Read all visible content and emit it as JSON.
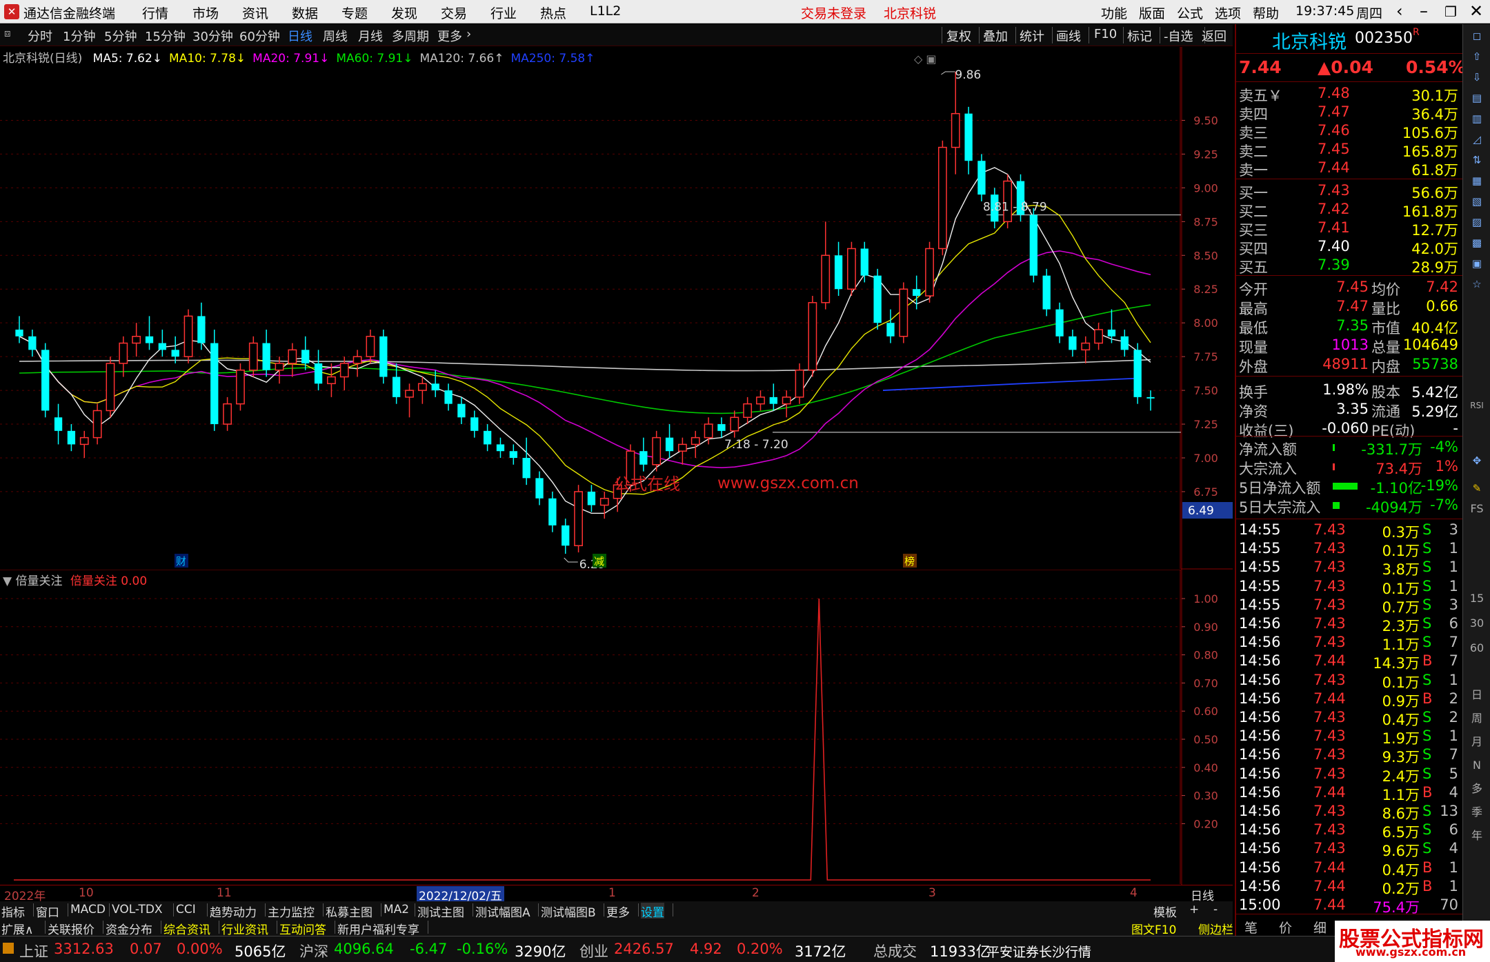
{
  "window": {
    "app_title": "通达信金融终端",
    "menus": [
      "行情",
      "市场",
      "资讯",
      "数据",
      "专题",
      "发现",
      "交易",
      "行业",
      "热点",
      "L1L2"
    ],
    "trade_status": "交易未登录",
    "stock_title": "北京科锐",
    "right_menus": [
      "功能",
      "版面",
      "公式",
      "选项",
      "帮助"
    ],
    "time": "19:37:45",
    "weekday": "周四"
  },
  "periods": {
    "items": [
      "分时",
      "1分钟",
      "5分钟",
      "15分钟",
      "30分钟",
      "60分钟",
      "日线",
      "周线",
      "月线",
      "多周期",
      "更多"
    ],
    "active": "日线",
    "right_tools": [
      "复权",
      "叠加",
      "统计",
      "画线",
      "F10",
      "标记",
      "-自选",
      "返回"
    ]
  },
  "main": {
    "label": "北京科锐(日线)",
    "ma": [
      {
        "name": "MA5: 7.62",
        "color": "#ffffff",
        "arrow": "↓"
      },
      {
        "name": "MA10: 7.78",
        "color": "#ffff00",
        "arrow": "↓"
      },
      {
        "name": "MA20: 7.91",
        "color": "#ff00ff",
        "arrow": "↓"
      },
      {
        "name": "MA60: 7.91",
        "color": "#00e600",
        "arrow": "↓"
      },
      {
        "name": "MA120: 7.66",
        "color": "#c0c0c0",
        "arrow": "↑"
      },
      {
        "name": "MA250: 7.58",
        "color": "#2040ff",
        "arrow": "↑"
      }
    ],
    "annotations": {
      "high": "9.86",
      "low": "6.29",
      "range_high": "8.81 - 8.79",
      "range_low": "7.18 - 7.20",
      "current_tag": "6.49",
      "site_text": "公式在线",
      "site_url": "www.gszx.com.cn",
      "markers": [
        "财",
        "减",
        "榜"
      ]
    }
  },
  "indicator": {
    "name": "倍量关注",
    "value_label": "倍量关注",
    "value": "0.00"
  },
  "y_axis_main": [
    "9.50",
    "9.25",
    "9.00",
    "8.75",
    "8.50",
    "8.25",
    "8.00",
    "7.75",
    "7.50",
    "7.25",
    "7.00",
    "6.75"
  ],
  "y_axis_sub": [
    "1.00",
    "0.90",
    "0.80",
    "0.70",
    "0.60",
    "0.50",
    "0.40",
    "0.30",
    "0.20"
  ],
  "x_axis": {
    "labels": [
      "2022年",
      "10",
      "11",
      "2022/12/02/五",
      "1",
      "2",
      "3",
      "4"
    ],
    "period": "日线"
  },
  "tabs_row1": [
    "指标",
    "窗口",
    "MACD",
    "VOL-TDX",
    "CCI",
    "趋势动力",
    "主力监控",
    "私募主图",
    "MA2",
    "测试主图",
    "测试幅图A",
    "测试幅图B",
    "更多",
    "设置"
  ],
  "tabs_row1_right": [
    "模板",
    "+",
    "-"
  ],
  "tabs_row2": [
    "扩展∧",
    "关联报价",
    "资金分布",
    "综合资讯",
    "行业资讯",
    "互动问答",
    "新用户福利专享"
  ],
  "tabs_row2_right": [
    "图文F10",
    "侧边栏《"
  ],
  "quote": {
    "name": "北京科锐",
    "code": "002350",
    "code_flag": "R",
    "price": "7.44",
    "change": "▲0.04",
    "pct": "0.54%",
    "asks": [
      {
        "label": "卖五",
        "price": "7.48",
        "vol": "30.1万"
      },
      {
        "label": "卖四",
        "price": "7.47",
        "vol": "36.4万"
      },
      {
        "label": "卖三",
        "price": "7.46",
        "vol": "105.6万"
      },
      {
        "label": "卖二",
        "price": "7.45",
        "vol": "165.8万"
      },
      {
        "label": "卖一",
        "price": "7.44",
        "vol": "61.8万"
      }
    ],
    "bids": [
      {
        "label": "买一",
        "price": "7.43",
        "vol": "56.6万"
      },
      {
        "label": "买二",
        "price": "7.42",
        "vol": "161.8万"
      },
      {
        "label": "买三",
        "price": "7.41",
        "vol": "12.7万"
      },
      {
        "label": "买四",
        "price": "7.40",
        "vol": "42.0万"
      },
      {
        "label": "买五",
        "price": "7.39",
        "vol": "28.9万"
      }
    ],
    "stats": [
      [
        "今开",
        "7.45",
        "均价",
        "7.42"
      ],
      [
        "最高",
        "7.47",
        "量比",
        "0.66"
      ],
      [
        "最低",
        "7.35",
        "市值",
        "40.4亿"
      ],
      [
        "现量",
        "1013",
        "总量",
        "104649"
      ],
      [
        "外盘",
        "48911",
        "内盘",
        "55738"
      ],
      [
        "换手",
        "1.98%",
        "股本",
        "5.42亿"
      ],
      [
        "净资",
        "3.35",
        "流通",
        "5.29亿"
      ],
      [
        "收益(三)",
        "-0.060",
        "PE(动)",
        "-"
      ]
    ],
    "flows": [
      [
        "净流入额",
        "-331.7万",
        "-4%"
      ],
      [
        "大宗流入",
        "73.4万",
        "1%"
      ],
      [
        "5日净流入额",
        "-1.10亿",
        "-19%"
      ],
      [
        "5日大宗流入",
        "-4094万",
        "-7%"
      ]
    ],
    "ticks": [
      [
        "14:55",
        "7.43",
        "0.3万",
        "S",
        "3"
      ],
      [
        "14:55",
        "7.43",
        "0.1万",
        "S",
        "1"
      ],
      [
        "14:55",
        "7.43",
        "3.8万",
        "S",
        "1"
      ],
      [
        "14:55",
        "7.43",
        "0.1万",
        "S",
        "1"
      ],
      [
        "14:55",
        "7.43",
        "0.7万",
        "S",
        "3"
      ],
      [
        "14:56",
        "7.43",
        "2.3万",
        "S",
        "6"
      ],
      [
        "14:56",
        "7.43",
        "1.1万",
        "S",
        "7"
      ],
      [
        "14:56",
        "7.44",
        "14.3万",
        "B",
        "7"
      ],
      [
        "14:56",
        "7.43",
        "0.1万",
        "S",
        "1"
      ],
      [
        "14:56",
        "7.44",
        "0.9万",
        "B",
        "2"
      ],
      [
        "14:56",
        "7.43",
        "0.4万",
        "S",
        "2"
      ],
      [
        "14:56",
        "7.43",
        "1.9万",
        "S",
        "1"
      ],
      [
        "14:56",
        "7.43",
        "9.3万",
        "S",
        "7"
      ],
      [
        "14:56",
        "7.43",
        "2.4万",
        "S",
        "5"
      ],
      [
        "14:56",
        "7.44",
        "1.1万",
        "B",
        "4"
      ],
      [
        "14:56",
        "7.43",
        "8.6万",
        "S",
        "13"
      ],
      [
        "14:56",
        "7.43",
        "6.5万",
        "S",
        "6"
      ],
      [
        "14:56",
        "7.43",
        "9.6万",
        "S",
        "4"
      ],
      [
        "14:56",
        "7.44",
        "0.4万",
        "B",
        "1"
      ],
      [
        "14:56",
        "7.44",
        "0.2万",
        "B",
        "1"
      ],
      [
        "15:00",
        "7.44",
        "75.4万",
        "",
        "70"
      ]
    ],
    "bottom_tabs": [
      "笔",
      "价",
      "细",
      "势"
    ]
  },
  "status": {
    "items": [
      [
        "上证",
        "3312.63",
        "0.07",
        "0.00%",
        "5065亿"
      ],
      [
        "沪深",
        "4096.64",
        "-6.47",
        "-0.16%",
        "3290亿"
      ],
      [
        "创业",
        "2426.57",
        "4.92",
        "0.20%",
        "3172亿"
      ]
    ],
    "total_label": "总成交",
    "total": "11933亿",
    "broker": "平安证券长沙行情"
  },
  "side_tools": [
    "日",
    "周",
    "月",
    "N",
    "多",
    "季",
    "年",
    "15",
    "30",
    "60",
    "RSI",
    "FS"
  ],
  "watermark": "股票公式指标网",
  "watermark_url": "www.gszx.com.cn",
  "chart_data": {
    "type": "candlestick",
    "ylim": [
      6.29,
      9.86
    ],
    "candles": [
      [
        7.95,
        8.05,
        7.85,
        7.9
      ],
      [
        7.9,
        7.95,
        7.75,
        7.8
      ],
      [
        7.8,
        7.85,
        7.3,
        7.35
      ],
      [
        7.3,
        7.4,
        7.1,
        7.2
      ],
      [
        7.2,
        7.25,
        7.05,
        7.1
      ],
      [
        7.1,
        7.2,
        7.0,
        7.15
      ],
      [
        7.15,
        7.4,
        7.1,
        7.35
      ],
      [
        7.35,
        7.75,
        7.3,
        7.7
      ],
      [
        7.7,
        7.9,
        7.6,
        7.85
      ],
      [
        7.85,
        8.0,
        7.75,
        7.9
      ],
      [
        7.9,
        8.05,
        7.8,
        7.85
      ],
      [
        7.85,
        7.95,
        7.75,
        7.8
      ],
      [
        7.8,
        7.9,
        7.7,
        7.75
      ],
      [
        7.75,
        8.1,
        7.7,
        8.05
      ],
      [
        8.05,
        8.15,
        7.8,
        7.85
      ],
      [
        7.85,
        7.95,
        7.2,
        7.25
      ],
      [
        7.25,
        7.45,
        7.2,
        7.4
      ],
      [
        7.4,
        7.7,
        7.35,
        7.65
      ],
      [
        7.65,
        7.9,
        7.6,
        7.85
      ],
      [
        7.85,
        7.95,
        7.6,
        7.65
      ],
      [
        7.65,
        7.75,
        7.55,
        7.7
      ],
      [
        7.7,
        7.85,
        7.6,
        7.8
      ],
      [
        7.8,
        7.9,
        7.65,
        7.7
      ],
      [
        7.7,
        7.8,
        7.5,
        7.55
      ],
      [
        7.55,
        7.7,
        7.45,
        7.6
      ],
      [
        7.6,
        7.75,
        7.5,
        7.7
      ],
      [
        7.7,
        7.8,
        7.6,
        7.75
      ],
      [
        7.75,
        7.95,
        7.7,
        7.9
      ],
      [
        7.9,
        7.95,
        7.55,
        7.6
      ],
      [
        7.6,
        7.7,
        7.4,
        7.45
      ],
      [
        7.45,
        7.55,
        7.3,
        7.5
      ],
      [
        7.5,
        7.6,
        7.4,
        7.55
      ],
      [
        7.55,
        7.65,
        7.45,
        7.5
      ],
      [
        7.5,
        7.55,
        7.35,
        7.4
      ],
      [
        7.4,
        7.45,
        7.25,
        7.3
      ],
      [
        7.3,
        7.35,
        7.15,
        7.2
      ],
      [
        7.2,
        7.25,
        7.05,
        7.1
      ],
      [
        7.1,
        7.15,
        7.0,
        7.05
      ],
      [
        7.05,
        7.1,
        6.95,
        7.0
      ],
      [
        7.0,
        7.15,
        6.8,
        6.85
      ],
      [
        6.85,
        6.9,
        6.65,
        6.7
      ],
      [
        6.7,
        6.75,
        6.45,
        6.5
      ],
      [
        6.5,
        6.55,
        6.29,
        6.35
      ],
      [
        6.35,
        6.8,
        6.3,
        6.75
      ],
      [
        6.75,
        6.8,
        6.6,
        6.65
      ],
      [
        6.65,
        6.75,
        6.55,
        6.7
      ],
      [
        6.7,
        6.85,
        6.6,
        6.8
      ],
      [
        6.8,
        7.1,
        6.75,
        7.05
      ],
      [
        7.05,
        7.15,
        6.9,
        6.95
      ],
      [
        6.95,
        7.2,
        6.9,
        7.15
      ],
      [
        7.15,
        7.25,
        7.0,
        7.05
      ],
      [
        7.05,
        7.15,
        6.95,
        7.1
      ],
      [
        7.1,
        7.2,
        7.0,
        7.15
      ],
      [
        7.15,
        7.3,
        7.1,
        7.25
      ],
      [
        7.25,
        7.3,
        7.15,
        7.2
      ],
      [
        7.2,
        7.35,
        7.15,
        7.3
      ],
      [
        7.3,
        7.45,
        7.25,
        7.4
      ],
      [
        7.4,
        7.5,
        7.35,
        7.45
      ],
      [
        7.45,
        7.55,
        7.35,
        7.4
      ],
      [
        7.4,
        7.5,
        7.3,
        7.45
      ],
      [
        7.45,
        7.7,
        7.4,
        7.65
      ],
      [
        7.65,
        8.2,
        7.6,
        8.15
      ],
      [
        8.15,
        8.75,
        8.1,
        8.5
      ],
      [
        8.5,
        8.6,
        8.2,
        8.25
      ],
      [
        8.25,
        8.6,
        8.2,
        8.55
      ],
      [
        8.55,
        8.6,
        8.3,
        8.35
      ],
      [
        8.35,
        8.4,
        7.95,
        8.0
      ],
      [
        8.0,
        8.1,
        7.85,
        7.9
      ],
      [
        7.9,
        8.3,
        7.85,
        8.25
      ],
      [
        8.25,
        8.35,
        8.1,
        8.2
      ],
      [
        8.2,
        8.6,
        8.15,
        8.55
      ],
      [
        8.55,
        9.35,
        8.5,
        9.3
      ],
      [
        9.3,
        9.86,
        9.1,
        9.55
      ],
      [
        9.55,
        9.6,
        9.1,
        9.2
      ],
      [
        9.2,
        9.25,
        8.9,
        8.95
      ],
      [
        8.95,
        9.0,
        8.7,
        8.75
      ],
      [
        8.75,
        9.1,
        8.7,
        9.05
      ],
      [
        9.05,
        9.1,
        8.75,
        8.8
      ],
      [
        8.8,
        8.85,
        8.3,
        8.35
      ],
      [
        8.35,
        8.4,
        8.05,
        8.1
      ],
      [
        8.1,
        8.15,
        7.85,
        7.9
      ],
      [
        7.9,
        7.95,
        7.75,
        7.8
      ],
      [
        7.8,
        7.9,
        7.7,
        7.85
      ],
      [
        7.85,
        8.0,
        7.8,
        7.95
      ],
      [
        7.95,
        8.1,
        7.85,
        7.9
      ],
      [
        7.9,
        7.95,
        7.75,
        7.8
      ],
      [
        7.8,
        7.85,
        7.4,
        7.45
      ],
      [
        7.45,
        7.5,
        7.35,
        7.44
      ]
    ],
    "volume_signal_peak": 1.0
  }
}
